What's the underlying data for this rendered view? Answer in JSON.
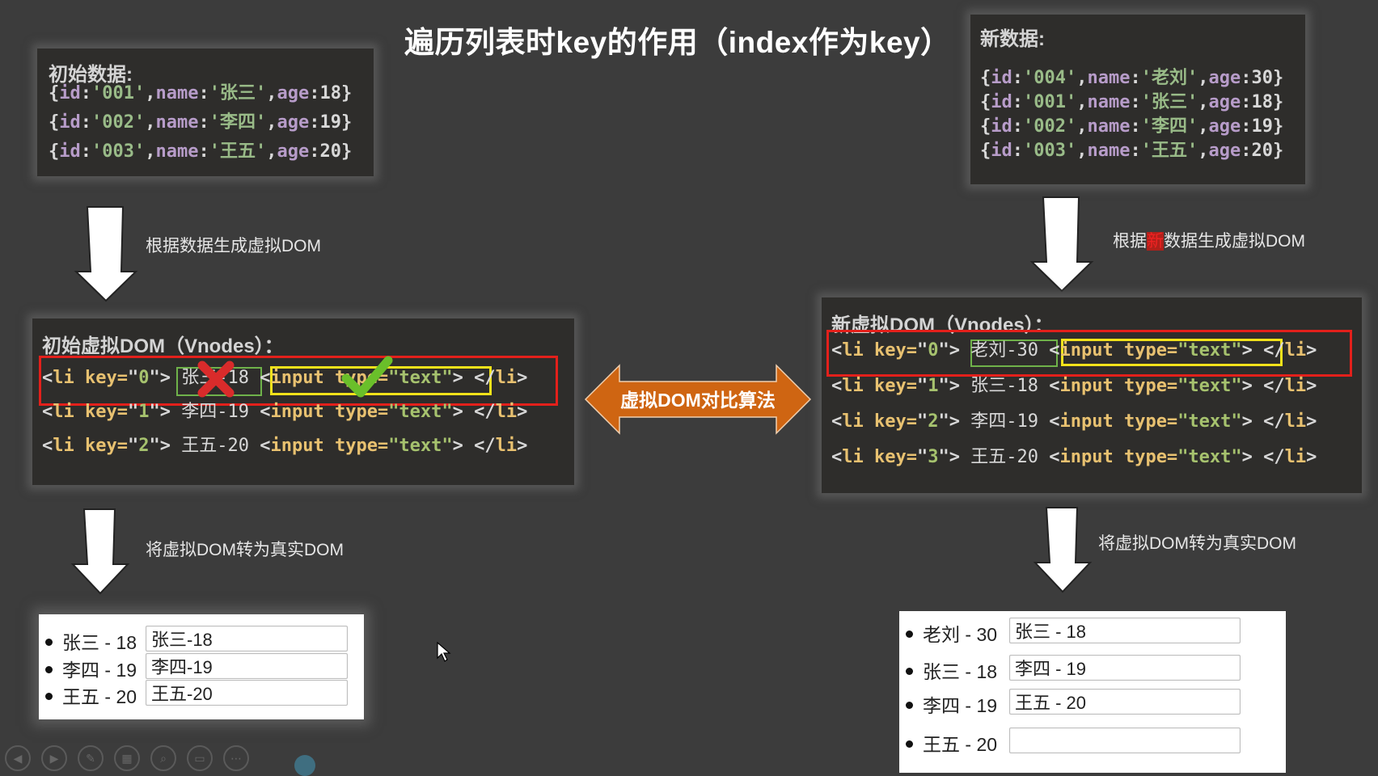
{
  "title": "遍历列表时key的作用（index作为key）",
  "initial_data": {
    "heading": "初始数据:",
    "rows": [
      {
        "id": "001",
        "name": "张三",
        "age": "18"
      },
      {
        "id": "002",
        "name": "李四",
        "age": "19"
      },
      {
        "id": "003",
        "name": "王五",
        "age": "20"
      }
    ]
  },
  "new_data": {
    "heading": "新数据:",
    "rows": [
      {
        "id": "004",
        "name": "老刘",
        "age": "30"
      },
      {
        "id": "001",
        "name": "张三",
        "age": "18"
      },
      {
        "id": "002",
        "name": "李四",
        "age": "19"
      },
      {
        "id": "003",
        "name": "王五",
        "age": "20"
      }
    ]
  },
  "captions": {
    "generate_vdom": "根据数据生成虚拟DOM",
    "generate_new_vdom_pre": "根据",
    "generate_new_vdom_hl": "新",
    "generate_new_vdom_post": "数据生成虚拟DOM",
    "to_real_dom_left": "将虚拟DOM转为真实DOM",
    "to_real_dom_right": "将虚拟DOM转为真实DOM"
  },
  "initial_vdom": {
    "heading": "初始虚拟DOM（Vnodes）：",
    "rows": [
      {
        "key": "0",
        "text": "张三-18"
      },
      {
        "key": "1",
        "text": "李四-19"
      },
      {
        "key": "2",
        "text": "王五-20"
      }
    ]
  },
  "new_vdom": {
    "heading": "新虚拟DOM（Vnodes）：",
    "rows": [
      {
        "key": "0",
        "text": "老刘-30"
      },
      {
        "key": "1",
        "text": "张三-18"
      },
      {
        "key": "2",
        "text": "李四-19"
      },
      {
        "key": "3",
        "text": "王五-20"
      }
    ]
  },
  "code_tokens": {
    "li_open": "<li",
    "key_attr": "key=",
    "input_open": "<input",
    "type_attr": "type=",
    "type_value": "\"text\"",
    "tag_close": ">",
    "li_close": "</li>"
  },
  "diff_label": "虚拟DOM对比算法",
  "initial_real_dom": [
    {
      "label": "张三 - 18",
      "input_value": "张三-18"
    },
    {
      "label": "李四 - 19",
      "input_value": "李四-19"
    },
    {
      "label": "王五 - 20",
      "input_value": "王五-20"
    }
  ],
  "new_real_dom": [
    {
      "label": "老刘 - 30",
      "input_value": "张三 - 18"
    },
    {
      "label": "张三 - 18",
      "input_value": "李四 - 19"
    },
    {
      "label": "李四 - 19",
      "input_value": "王五 - 20"
    },
    {
      "label": "王五 - 20",
      "input_value": ""
    }
  ],
  "annotations": {
    "text_mark": "cross-icon",
    "input_mark": "check-icon"
  },
  "toolbar": [
    "prev-icon",
    "next-icon",
    "pen-icon",
    "slides-icon",
    "zoom-icon",
    "screen-icon",
    "more-icon"
  ],
  "colors": {
    "background": "#3c3c3c",
    "panel": "#2e2d2b",
    "highlight_row": "#e3201b",
    "text_box": "#6fb24a",
    "input_box": "#f2e21a",
    "diff_arrow": "#d4680f"
  }
}
